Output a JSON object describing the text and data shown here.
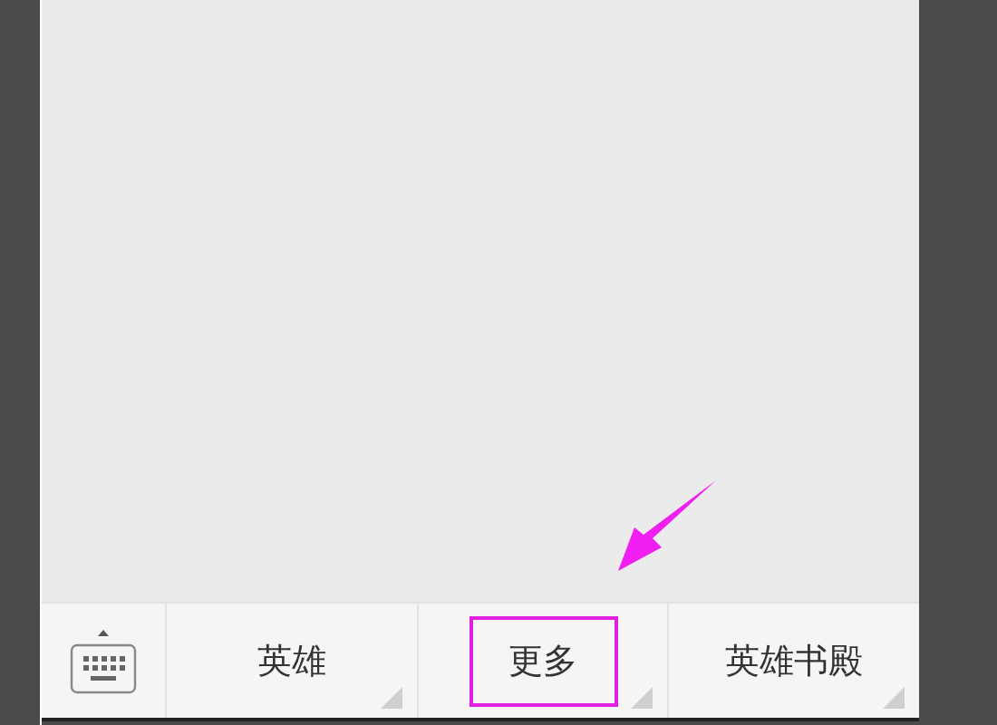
{
  "menu_bar": {
    "items": [
      {
        "label": "英雄",
        "highlighted": false
      },
      {
        "label": "更多",
        "highlighted": true
      },
      {
        "label": "英雄书殿",
        "highlighted": false
      }
    ]
  }
}
